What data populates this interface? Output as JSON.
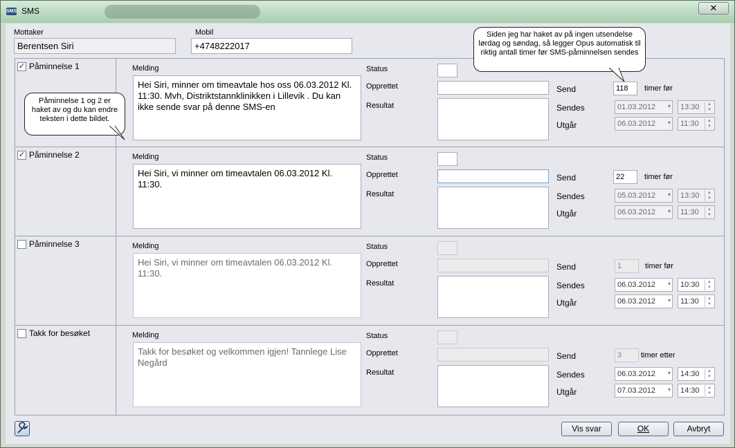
{
  "window": {
    "title": "SMS",
    "close_label": "✕"
  },
  "recipient": {
    "label": "Mottaker",
    "value": "Berentsen Siri",
    "mobile_label": "Mobil",
    "mobile_value": "+4748222017"
  },
  "callouts": {
    "top": "Siden jeg har haket av på ingen utsendelse lørdag og søndag, så legger Opus automatisk til riktig antall timer før SMS-påminnelsen sendes",
    "left": "Påminnelse 1 og 2 er haket av og du kan endre teksten i dette bildet."
  },
  "labels": {
    "melding": "Melding",
    "status": "Status",
    "opprettet": "Opprettet",
    "resultat": "Resultat",
    "send": "Send",
    "sendes": "Sendes",
    "utgar": "Utgår"
  },
  "rows": [
    {
      "name": "Påminnelse 1",
      "checked": true,
      "check_mark": "✓",
      "message": "Hei Siri, minner om timeavtale hos oss 06.03.2012 Kl. 11:30. Mvh, Distriktstannklinikken i Lillevik . Du kan ikke sende svar på denne SMS-en",
      "send_value": "118",
      "send_unit": "timer før",
      "sendes_date": "01.03.2012",
      "sendes_time": "13:30",
      "utgar_date": "06.03.2012",
      "utgar_time": "11:30"
    },
    {
      "name": "Påminnelse 2",
      "checked": true,
      "check_mark": "✓",
      "message": "Hei Siri, vi minner om timeavtalen 06.03.2012 Kl. 11:30.",
      "send_value": "22",
      "send_unit": "timer før",
      "sendes_date": "05.03.2012",
      "sendes_time": "13:30",
      "utgar_date": "06.03.2012",
      "utgar_time": "11:30"
    },
    {
      "name": "Påminnelse 3",
      "checked": false,
      "check_mark": "",
      "message": "Hei Siri, vi minner om timeavtalen 06.03.2012 Kl. 11:30.",
      "send_value": "1",
      "send_unit": "timer før",
      "sendes_date": "06.03.2012",
      "sendes_time": "10:30",
      "utgar_date": "06.03.2012",
      "utgar_time": "11:30"
    },
    {
      "name": "Takk for besøket",
      "checked": false,
      "check_mark": "",
      "message": "Takk for besøket og velkommen igjen! Tannlege Lise Negård",
      "send_value": "3",
      "send_unit": "timer etter",
      "sendes_date": "06.03.2012",
      "sendes_time": "14:30",
      "utgar_date": "07.03.2012",
      "utgar_time": "14:30"
    }
  ],
  "buttons": {
    "vis_svar": "Vis svar",
    "ok": "OK",
    "avbryt": "Avbryt"
  },
  "icons": {
    "title": "sms-icon",
    "tool": "wrench-icon",
    "dropdown": "▾",
    "spin_up": "▲",
    "spin_down": "▼"
  }
}
